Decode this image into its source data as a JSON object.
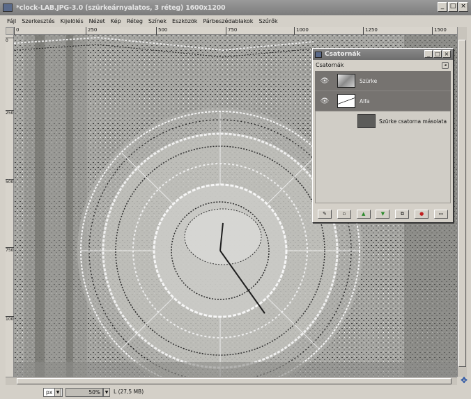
{
  "window": {
    "title": "*clock-LAB.JPG-3.0 (szürkeárnyalatos, 3 réteg) 1600x1200",
    "controls": [
      "_",
      "□",
      "×"
    ]
  },
  "menu": [
    "Fájl",
    "Szerkesztés",
    "Kijelölés",
    "Nézet",
    "Kép",
    "Réteg",
    "Színek",
    "Eszközök",
    "Párbeszédablakok",
    "Szűrők"
  ],
  "rulers": {
    "horizontal": [
      "0",
      "250",
      "500",
      "750",
      "1000",
      "1250",
      "1500"
    ],
    "vertical": [
      "0",
      "250",
      "500",
      "750",
      "1000"
    ]
  },
  "channels_dialog": {
    "title": "Csatornák",
    "tab_label": "Csatornák",
    "channels": [
      {
        "name": "Szürke",
        "icon": "eye-icon"
      },
      {
        "name": "Alfa",
        "icon": "eye-icon"
      }
    ],
    "selection_channel": "Szürke csatorna másolata",
    "toolbar_icons": [
      "edit-icon",
      "new-icon",
      "raise-icon",
      "lower-icon",
      "duplicate-icon",
      "delete-icon",
      "to-selection-icon"
    ]
  },
  "status": {
    "unit": "px",
    "zoom": "50%",
    "info": "L (27,5 MB)"
  },
  "colors": {
    "titlebar": "#8a8a8a",
    "dialog_bg": "#d4d0c8",
    "channel_list_bg": "#767370"
  }
}
